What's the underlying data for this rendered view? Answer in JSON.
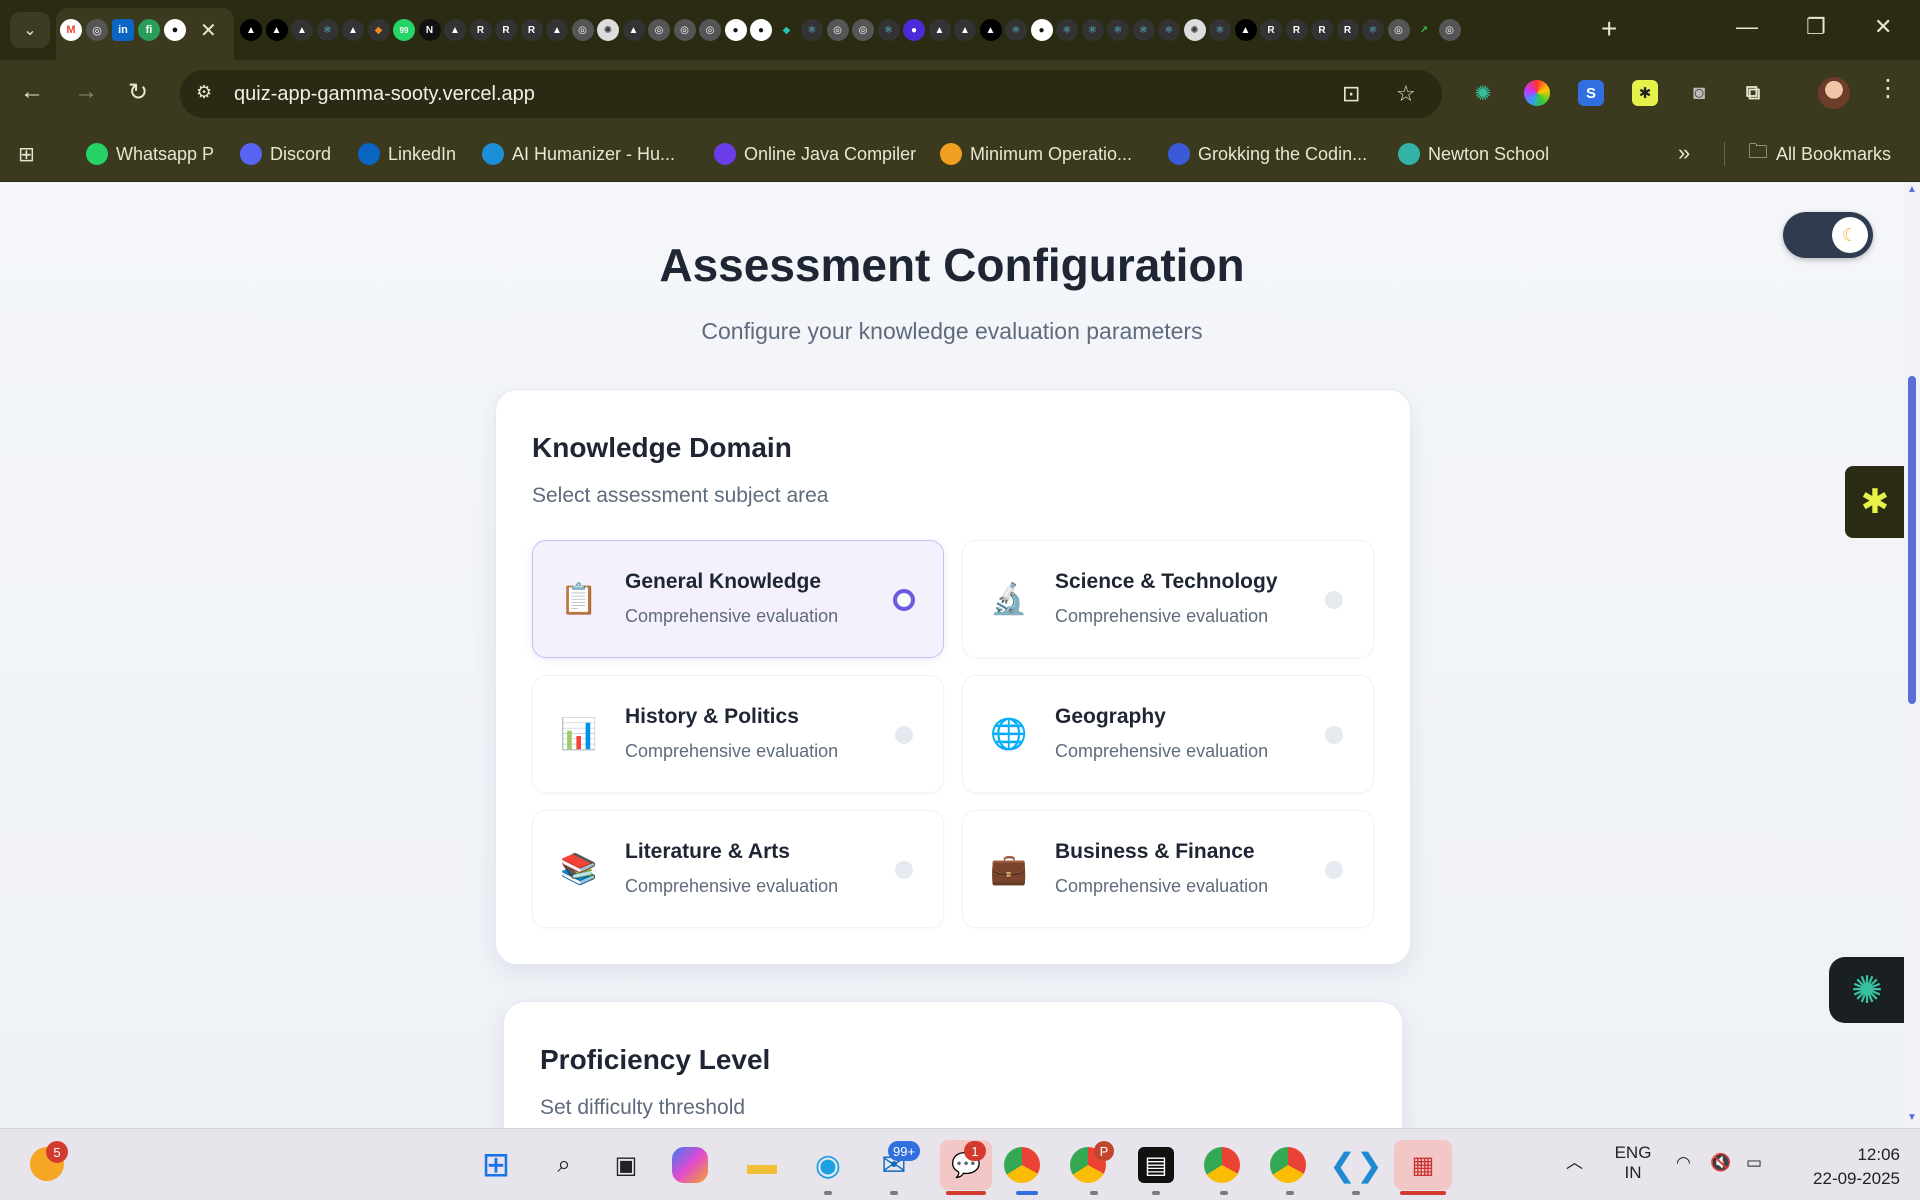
{
  "browser": {
    "url": "quiz-app-gamma-sooty.vercel.app",
    "bookmarks": [
      {
        "label": "Whatsapp P",
        "icon": "whatsapp-icon",
        "color": "#25d366"
      },
      {
        "label": "Discord",
        "icon": "discord-icon",
        "color": "#5865f2"
      },
      {
        "label": "LinkedIn",
        "icon": "linkedin-icon",
        "color": "#0a66c2"
      },
      {
        "label": "AI Humanizer - Hu...",
        "icon": "ai-humanizer-icon",
        "color": "#1d8fd6"
      },
      {
        "label": "Online Java Compiler",
        "icon": "java-compiler-icon",
        "color": "#6a3de8"
      },
      {
        "label": "Minimum Operatio...",
        "icon": "leetcode-icon",
        "color": "#f0a020"
      },
      {
        "label": "Grokking the Codin...",
        "icon": "grokking-icon",
        "color": "#3a5ad8"
      },
      {
        "label": "Newton School",
        "icon": "newton-school-icon",
        "color": "#33b3a6"
      }
    ],
    "all_bookmarks_label": "All Bookmarks"
  },
  "page": {
    "title": "Assessment Configuration",
    "subtitle": "Configure your knowledge evaluation parameters",
    "domain_section": {
      "title": "Knowledge Domain",
      "subtitle": "Select assessment subject area",
      "options": [
        {
          "name": "General Knowledge",
          "desc": "Comprehensive evaluation",
          "icon": "clipboard-icon",
          "glyph": "📋",
          "selected": true
        },
        {
          "name": "Science & Technology",
          "desc": "Comprehensive evaluation",
          "icon": "microscope-icon",
          "glyph": "🔬",
          "selected": false
        },
        {
          "name": "History & Politics",
          "desc": "Comprehensive evaluation",
          "icon": "bar-chart-icon",
          "glyph": "📊",
          "selected": false
        },
        {
          "name": "Geography",
          "desc": "Comprehensive evaluation",
          "icon": "globe-icon",
          "glyph": "🌐",
          "selected": false
        },
        {
          "name": "Literature & Arts",
          "desc": "Comprehensive evaluation",
          "icon": "books-icon",
          "glyph": "📚",
          "selected": false
        },
        {
          "name": "Business & Finance",
          "desc": "Comprehensive evaluation",
          "icon": "briefcase-icon",
          "glyph": "💼",
          "selected": false
        }
      ]
    },
    "proficiency_section": {
      "title": "Proficiency Level",
      "subtitle": "Set difficulty threshold"
    }
  },
  "taskbar": {
    "weather_badge": "5",
    "outlook_badge": "99+",
    "teams_badge": "1",
    "chrome_profile_badge": "P",
    "language": "ENG",
    "region": "IN",
    "time": "12:06",
    "date": "22-09-2025"
  }
}
